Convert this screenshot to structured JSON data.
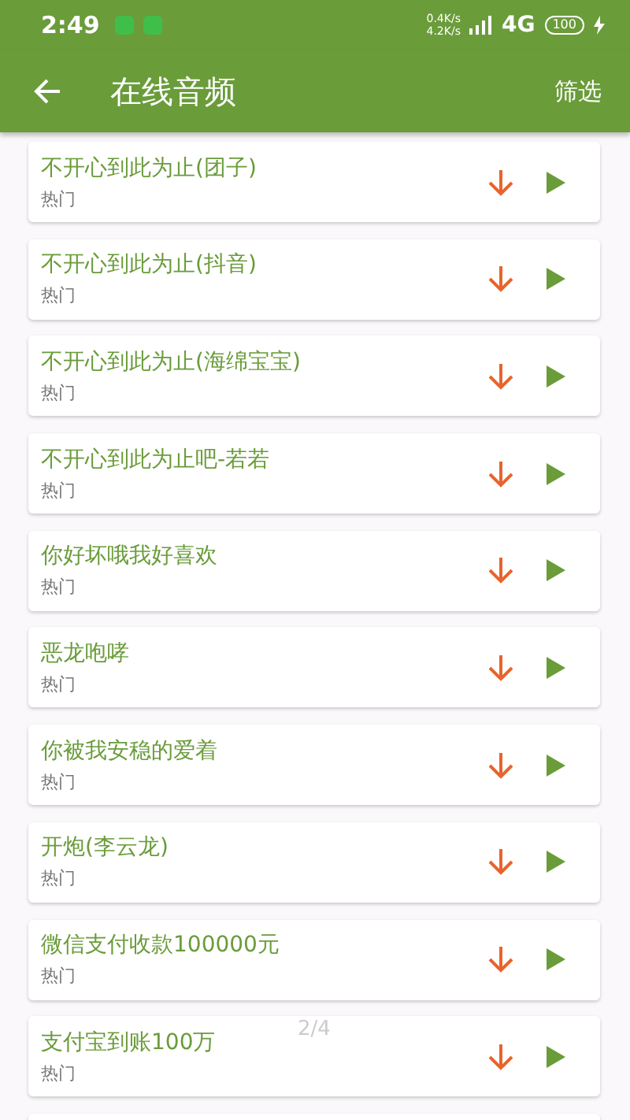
{
  "status_bar": {
    "time": "2:49",
    "upload_speed": "0.4K/s",
    "download_speed": "4.2K/s",
    "network": "4G",
    "battery": "100"
  },
  "toolbar": {
    "title": "在线音频",
    "action": "筛选"
  },
  "items": [
    {
      "title": "不开心到此为止(团子)",
      "tag": "热门"
    },
    {
      "title": "不开心到此为止(抖音)",
      "tag": "热门"
    },
    {
      "title": "不开心到此为止(海绵宝宝)",
      "tag": "热门"
    },
    {
      "title": "不开心到此为止吧-若若",
      "tag": "热门"
    },
    {
      "title": "你好坏哦我好喜欢",
      "tag": "热门"
    },
    {
      "title": "恶龙咆哮",
      "tag": "热门"
    },
    {
      "title": "你被我安稳的爱着",
      "tag": "热门"
    },
    {
      "title": "开炮(李云龙)",
      "tag": "热门"
    },
    {
      "title": "微信支付收款100000元",
      "tag": "热门"
    },
    {
      "title": "支付宝到账100万",
      "tag": "热门"
    }
  ],
  "page_indicator": "2/4"
}
